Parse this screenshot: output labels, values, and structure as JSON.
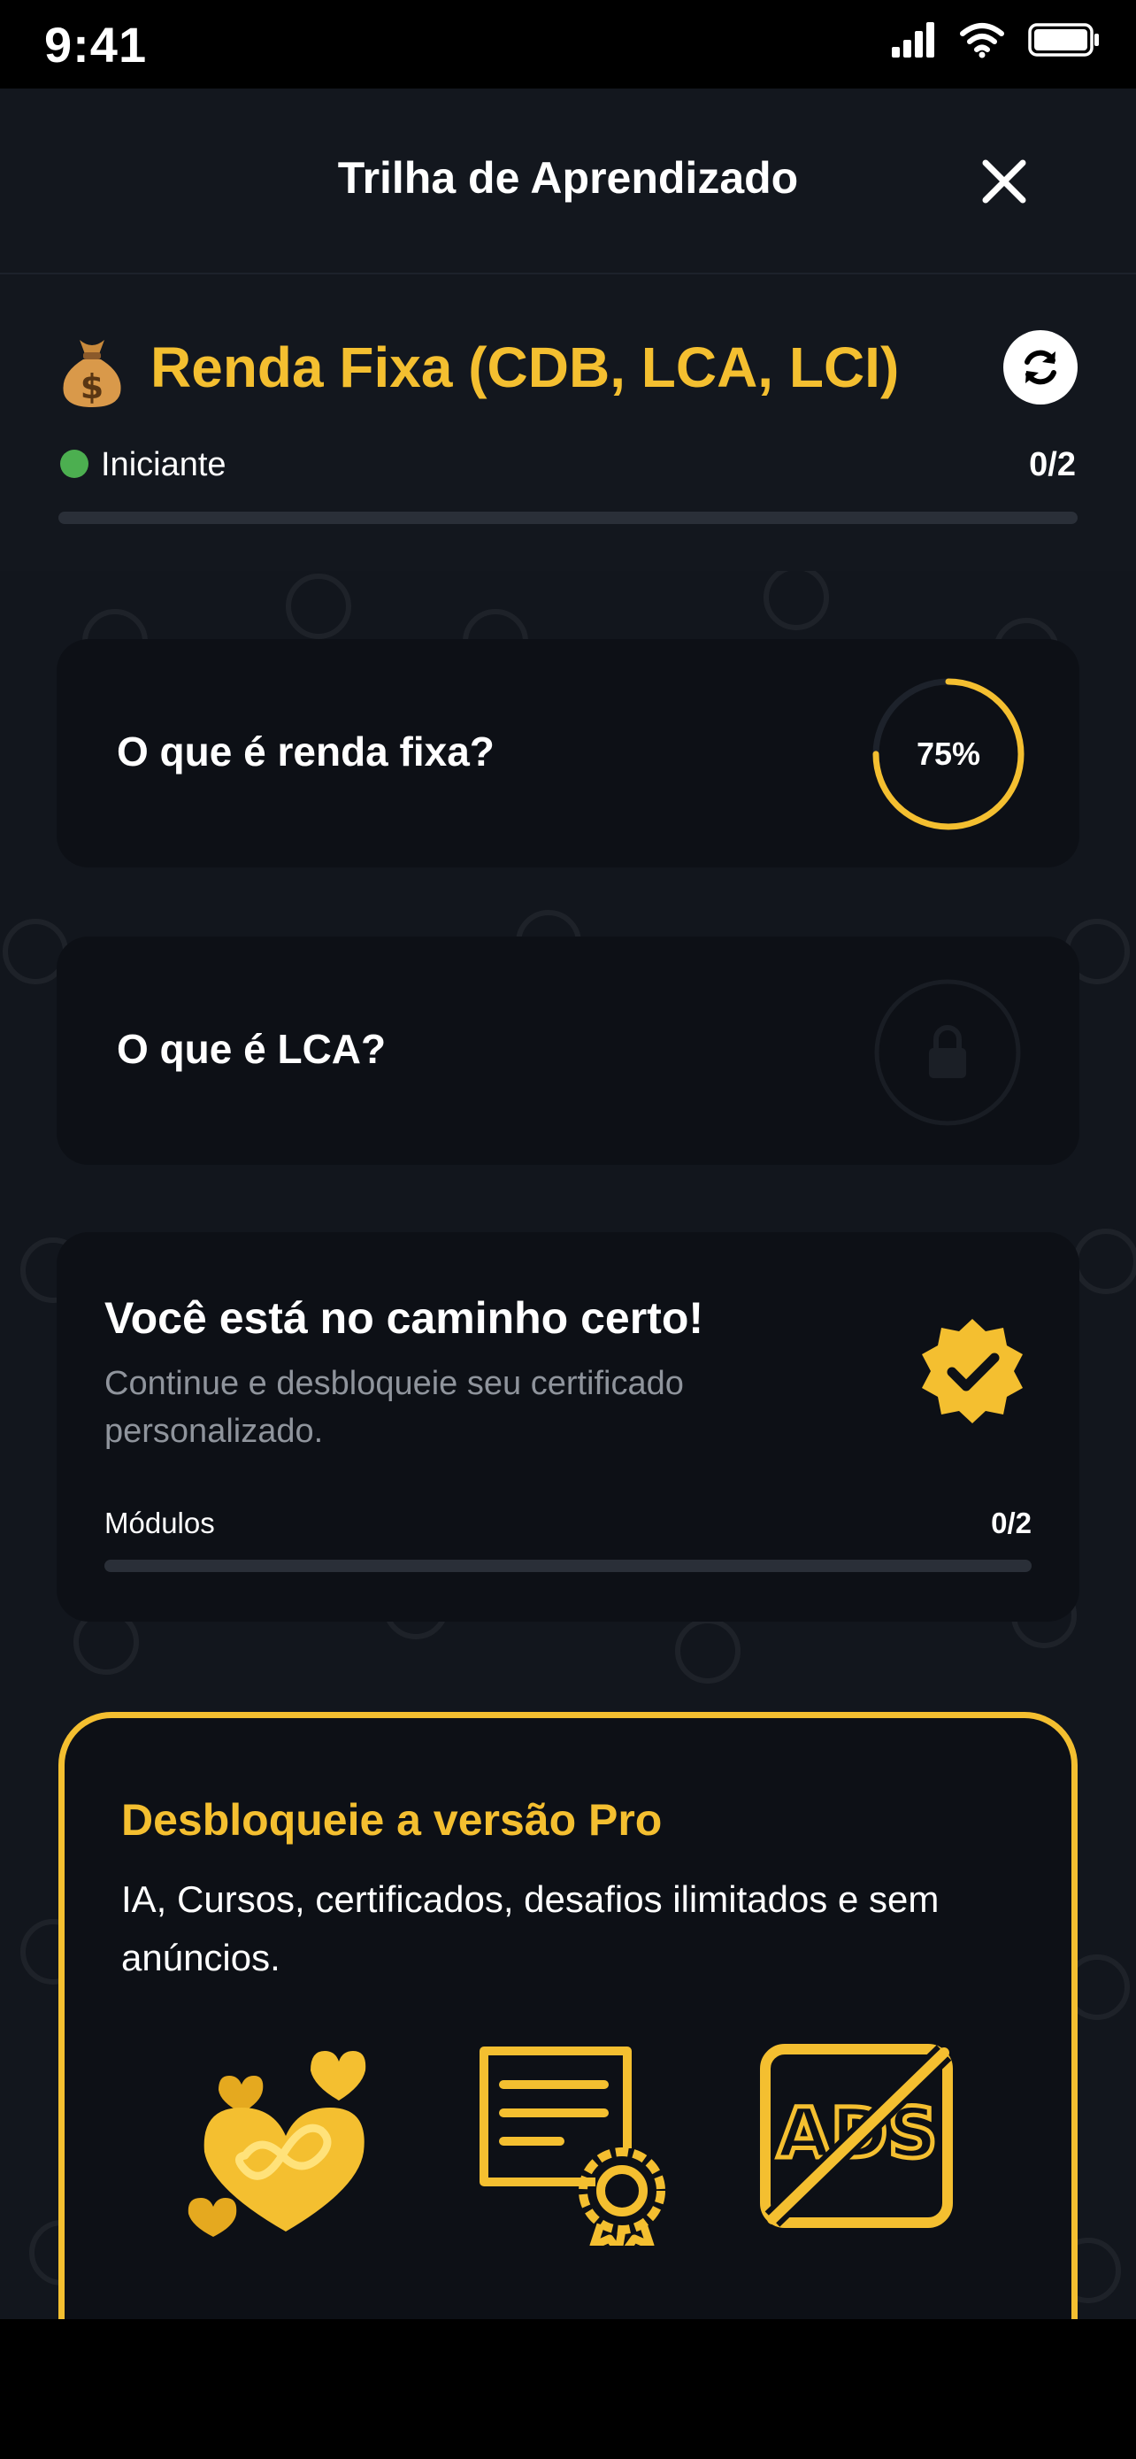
{
  "status_bar": {
    "time": "9:41"
  },
  "nav": {
    "title": "Trilha de Aprendizado",
    "close_icon": "close-icon"
  },
  "course": {
    "emoji_icon": "money-bag-icon",
    "title": "Renda Fixa (CDB, LCA, LCI)",
    "level": "Iniciante",
    "level_color": "#4caf50",
    "progress_text": "0/2",
    "progress": 0,
    "reload_icon": "sync-icon"
  },
  "lessons": [
    {
      "title": "O que é renda fixa?",
      "status": "in-progress",
      "progress_label": "75%",
      "progress": 0.75
    },
    {
      "title": "O que é LCA?",
      "status": "locked",
      "icon": "lock-icon"
    }
  ],
  "certificate": {
    "title": "Você está no caminho certo!",
    "description": "Continue e desbloqueie seu certificado personalizado.",
    "modules_label": "Módulos",
    "modules_count": "0/2",
    "progress": 0,
    "badge_icon": "verified-badge-icon"
  },
  "pro": {
    "title": "Desbloqueie a versão Pro",
    "description": "IA, Cursos, certificados, desafios ilimitados e sem anúncios.",
    "icons": [
      "infinite-hearts-icon",
      "certificate-icon",
      "no-ads-icon"
    ],
    "ads_text": "ADS"
  },
  "colors": {
    "accent": "#f4bf30",
    "background": "#12161d",
    "card": "#0d1016",
    "muted": "#8f949c"
  }
}
